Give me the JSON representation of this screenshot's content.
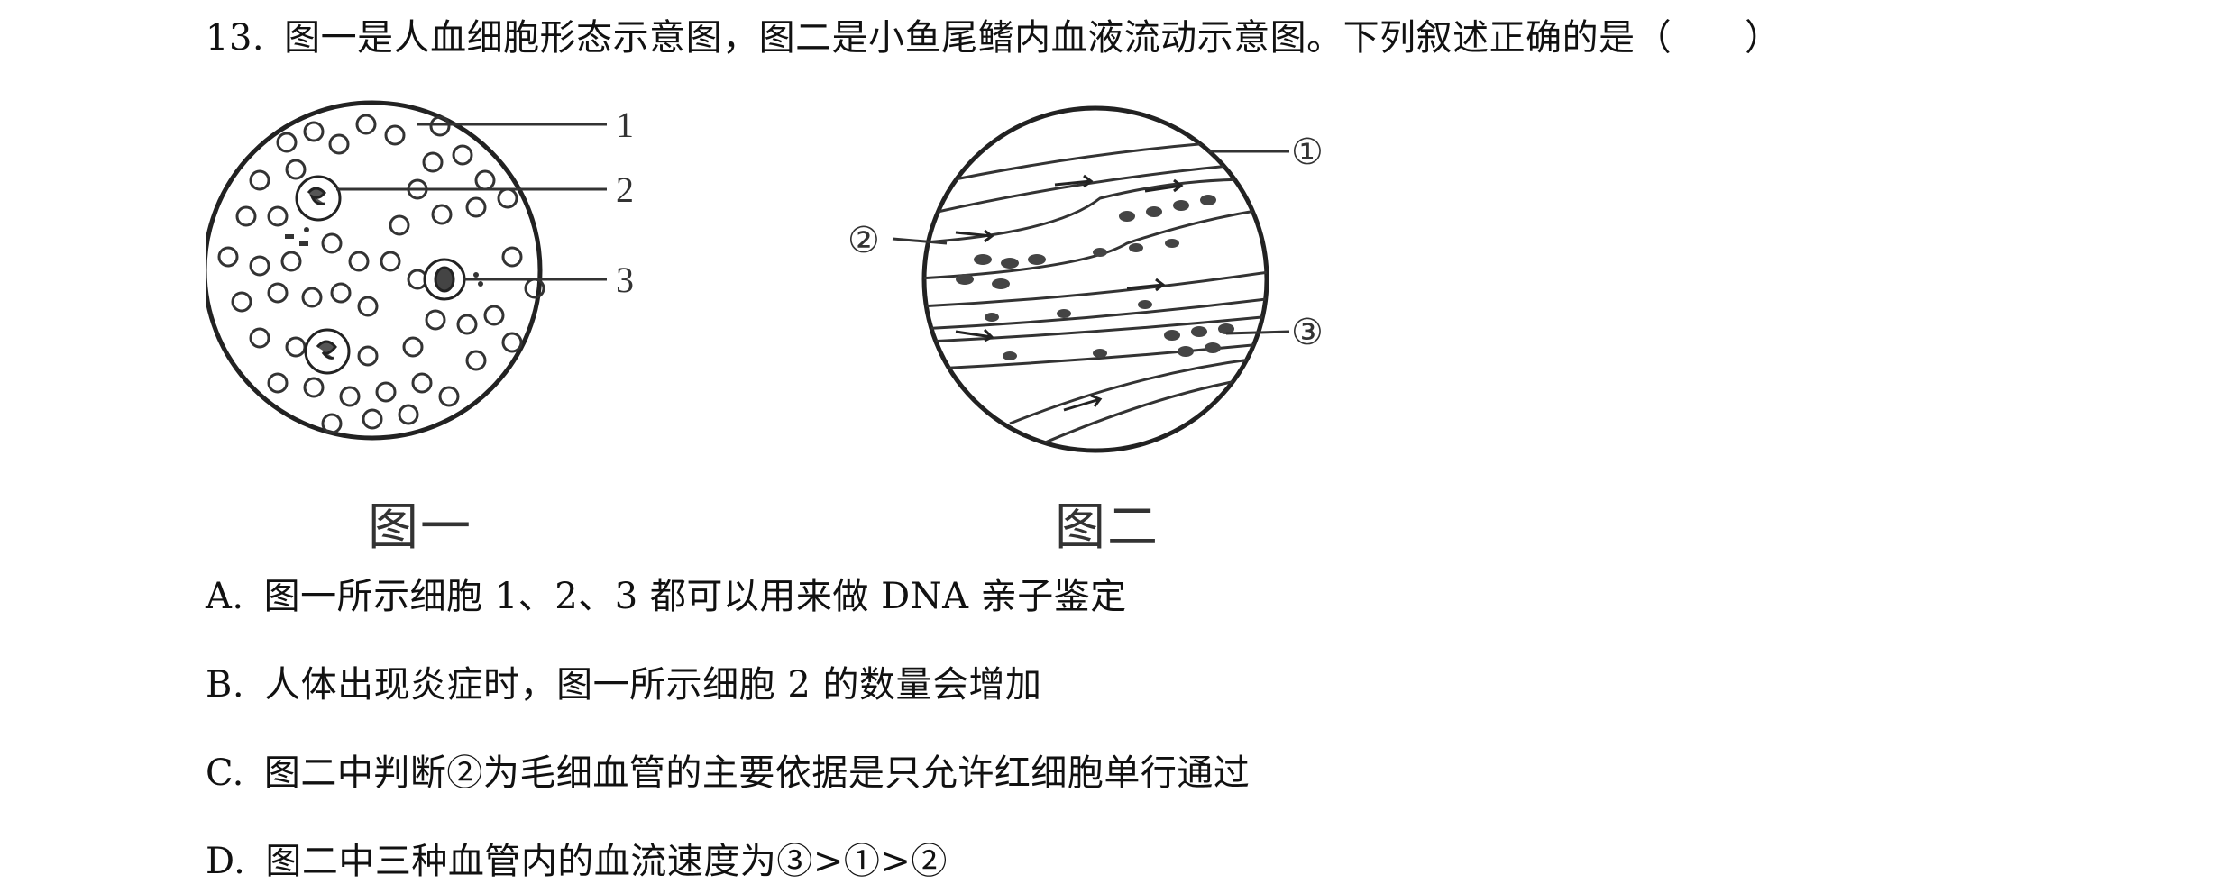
{
  "question": {
    "number": "13.",
    "stem": "图一是人血细胞形态示意图，图二是小鱼尾鳍内血液流动示意图。下列叙述正确的是（　　）"
  },
  "figures": {
    "fig1": {
      "caption": "图一",
      "labels": [
        "1",
        "2",
        "3"
      ]
    },
    "fig2": {
      "caption": "图二",
      "labels": [
        "①",
        "②",
        "③"
      ]
    }
  },
  "options": [
    {
      "letter": "A.",
      "text": "图一所示细胞 1、2、3 都可以用来做 DNA 亲子鉴定"
    },
    {
      "letter": "B.",
      "text": "人体出现炎症时，图一所示细胞 2 的数量会增加"
    },
    {
      "letter": "C.",
      "text": "图二中判断②为毛细血管的主要依据是只允许红细胞单行通过"
    },
    {
      "letter": "D.",
      "text": "图二中三种血管内的血流速度为③>①>②"
    }
  ]
}
